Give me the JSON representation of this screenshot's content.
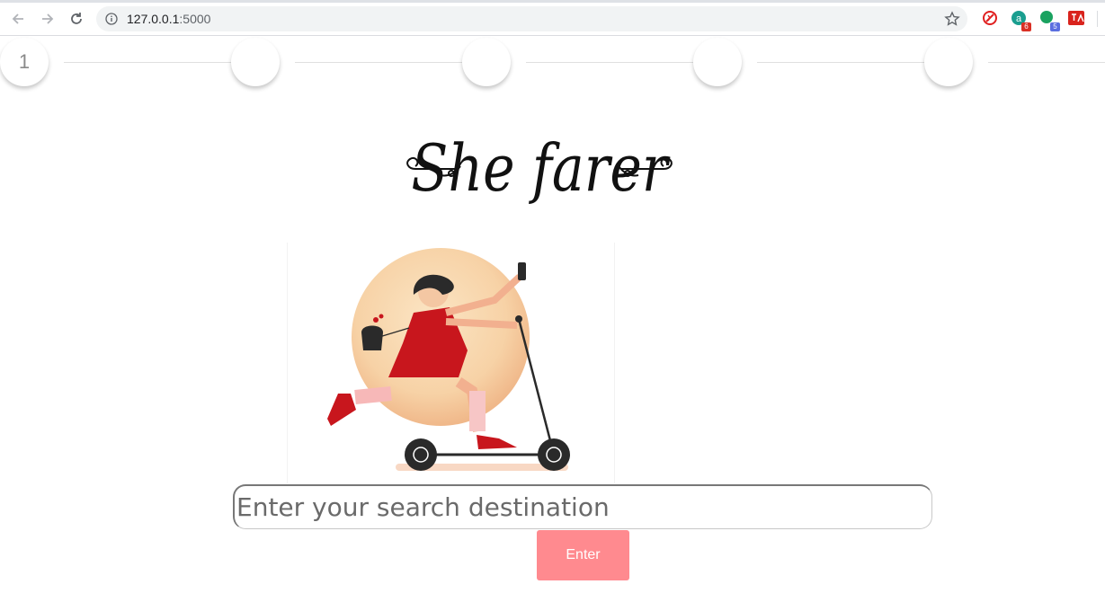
{
  "browser": {
    "url_host": "127.0.0.1",
    "url_port": ":5000",
    "extensions": [
      {
        "name": "extension-red-icon",
        "badge": ""
      },
      {
        "name": "extension-teal-icon",
        "badge": "6"
      },
      {
        "name": "extension-green-icon",
        "badge": "5"
      },
      {
        "name": "extension-translate-icon",
        "badge": ""
      }
    ]
  },
  "stepper": {
    "steps": [
      "1",
      "",
      "",
      "",
      ""
    ],
    "current": 1
  },
  "logo": {
    "text": "She farer"
  },
  "search": {
    "placeholder": "Enter your search destination",
    "value": ""
  },
  "actions": {
    "enter_label": "Enter"
  },
  "colors": {
    "accent": "#ff8a8f",
    "illustration_dress": "#c8161d",
    "illustration_circle": "#f9d8b0"
  }
}
